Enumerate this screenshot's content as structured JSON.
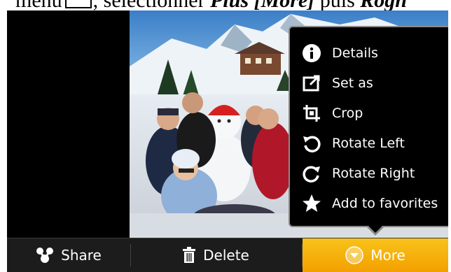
{
  "caption": {
    "part1": "menu",
    "part2": ", sélectionner",
    "more_word": "Plus [More]",
    "part3": "puis",
    "rotate_word": "Rogn"
  },
  "menu": {
    "items": [
      {
        "label": "Details",
        "icon": "info-icon"
      },
      {
        "label": "Set as",
        "icon": "set-as-icon"
      },
      {
        "label": "Crop",
        "icon": "crop-icon"
      },
      {
        "label": "Rotate Left",
        "icon": "rotate-left-icon"
      },
      {
        "label": "Rotate Right",
        "icon": "rotate-right-icon"
      },
      {
        "label": "Add to favorites",
        "icon": "star-icon"
      }
    ]
  },
  "actions": {
    "share": "Share",
    "delete": "Delete",
    "more": "More"
  },
  "colors": {
    "more_active": "#f3a000",
    "bar": "#1c1c1c"
  }
}
